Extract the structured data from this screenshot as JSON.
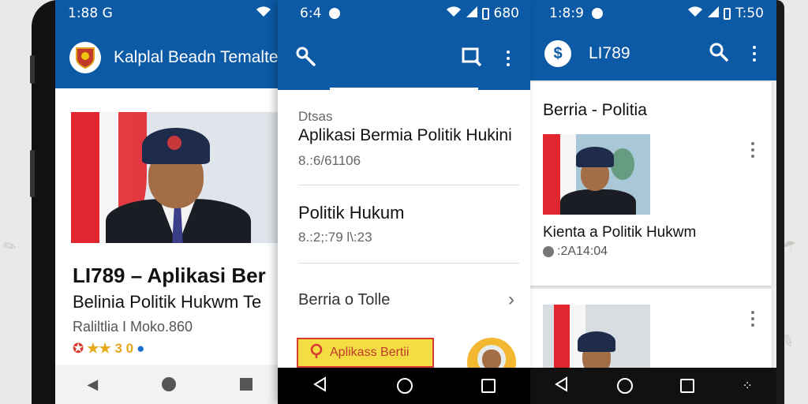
{
  "phone1": {
    "status_time": "1:88 G",
    "app_title": "Kalplal Beadn Temalte",
    "headline_line1": "LI789 – Aplikasi Ber",
    "headline_line2": "Belinia Politik Hukwm Te",
    "meta": "Raliltlia I Moko.860",
    "rating": "★★ 3 0"
  },
  "phone2": {
    "status_time": "6:4",
    "status_right": "680",
    "section_label": "Dtsas",
    "item1_title": "Aplikasi Bermia Politik Hukini",
    "item1_meta": "8.:6/61106",
    "item2_title": "Politik Hukum",
    "item2_meta": "8.:2;:79 l\\:23",
    "item3_title": "Berria o Tolle",
    "banner_label": "Aplikass Bertii"
  },
  "phone3": {
    "status_time": "1:8:9",
    "status_right": "T:50",
    "app_title": "LI789",
    "section_title": "Berria - Politia",
    "card1_title": "Kienta a Politik Hukwm",
    "card1_meta": ":2A14:04"
  },
  "colors": {
    "appbar": "#0c5aa6",
    "accent_yellow": "#f4dd43",
    "flag_red": "#e2262f"
  }
}
